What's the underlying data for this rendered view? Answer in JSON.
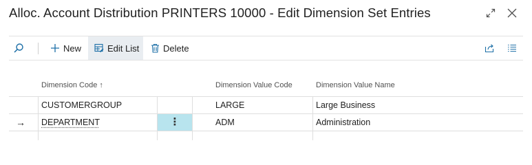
{
  "window": {
    "title": "Alloc. Account Distribution PRINTERS 10000 - Edit Dimension Set Entries",
    "expand_icon": "expand-icon",
    "close_icon": "close-icon"
  },
  "toolbar": {
    "search_icon": "search-icon",
    "new_label": "New",
    "edit_list_label": "Edit List",
    "delete_label": "Delete",
    "share_icon": "share-icon",
    "list_view_icon": "list-view-icon"
  },
  "table": {
    "columns": [
      "Dimension Code",
      "Dimension Value Code",
      "Dimension Value Name"
    ],
    "sort_indicator": "↑",
    "rows": [
      {
        "dimension_code": "CUSTOMERGROUP",
        "value_code": "LARGE",
        "value_name": "Large Business"
      },
      {
        "dimension_code": "DEPARTMENT",
        "value_code": "ADM",
        "value_name": "Administration",
        "current": true,
        "row_marker": "→",
        "row_menu": "⋮"
      }
    ]
  },
  "colors": {
    "accent": "#1b6ea6",
    "selected_cell": "#b8e4ee",
    "active_button": "#e9edf1"
  }
}
